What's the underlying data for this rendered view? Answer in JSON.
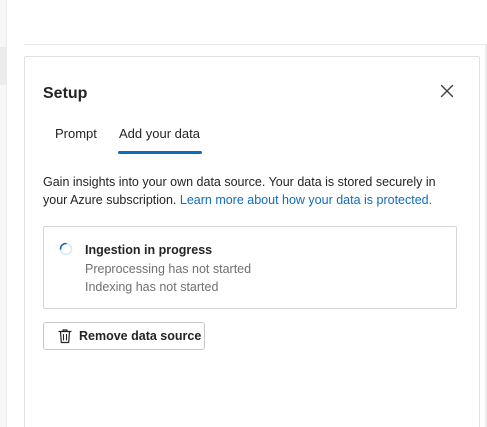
{
  "panel": {
    "title": "Setup",
    "close_icon": "close-icon"
  },
  "tabs": [
    {
      "label": "Prompt",
      "selected": false
    },
    {
      "label": "Add your data",
      "selected": true
    }
  ],
  "accent_color": "#0f6cbd",
  "description": {
    "text": "Gain insights into your own data source. Your data is stored securely in your Azure subscription. ",
    "link_text": "Learn more about how your data is protected."
  },
  "status": {
    "icon": "spinner-icon",
    "title": "Ingestion in progress",
    "lines": [
      "Preprocessing has not started",
      "Indexing has not started"
    ]
  },
  "actions": {
    "remove_icon": "trash-icon",
    "remove_label": "Remove data source"
  }
}
